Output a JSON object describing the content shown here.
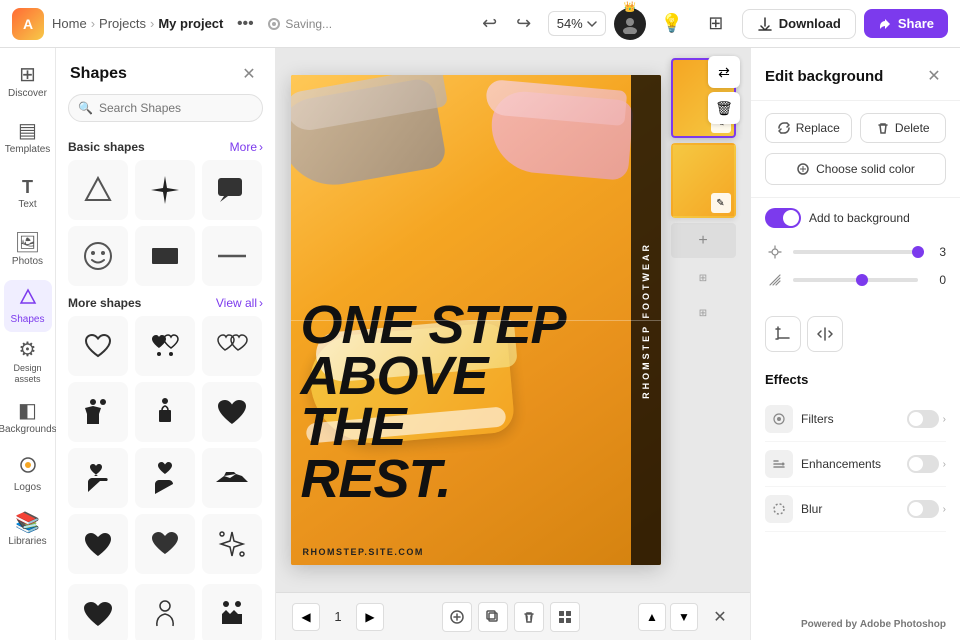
{
  "topbar": {
    "logo_text": "A",
    "breadcrumb": {
      "home": "Home",
      "projects": "Projects",
      "current": "My project"
    },
    "more_label": "•••",
    "saving_text": "Saving...",
    "zoom_level": "54%",
    "download_label": "Download",
    "share_label": "Share"
  },
  "sidebar": {
    "items": [
      {
        "id": "discover",
        "label": "Discover",
        "icon": "⊞"
      },
      {
        "id": "templates",
        "label": "Templates",
        "icon": "⊡"
      },
      {
        "id": "text",
        "label": "Text",
        "icon": "T"
      },
      {
        "id": "photos",
        "label": "Photos",
        "icon": "🖼"
      },
      {
        "id": "shapes",
        "label": "Shapes",
        "icon": "⬡",
        "active": true
      },
      {
        "id": "design-assets",
        "label": "Design assets",
        "icon": "🎨"
      },
      {
        "id": "backgrounds",
        "label": "Backgrounds",
        "icon": "◧"
      },
      {
        "id": "logos",
        "label": "Logos",
        "icon": "⊕"
      },
      {
        "id": "libraries",
        "label": "Libraries",
        "icon": "📚"
      }
    ]
  },
  "shapes_panel": {
    "title": "Shapes",
    "search_placeholder": "Search Shapes",
    "basic_shapes_label": "Basic shapes",
    "more_label": "More",
    "more_shapes_label": "More shapes",
    "view_all_label": "View all",
    "basic_shapes": [
      {
        "id": "triangle",
        "type": "triangle"
      },
      {
        "id": "star4",
        "type": "star4"
      },
      {
        "id": "speech",
        "type": "speech"
      },
      {
        "id": "circle-smile",
        "type": "circle-smile"
      },
      {
        "id": "rect",
        "type": "rect"
      },
      {
        "id": "line",
        "type": "line"
      }
    ],
    "more_shapes": [
      {
        "id": "heart-outline1",
        "type": "heart-outline"
      },
      {
        "id": "hearts2",
        "type": "two-hearts"
      },
      {
        "id": "hearts3",
        "type": "two-hearts-outline"
      },
      {
        "id": "people1",
        "type": "people-up"
      },
      {
        "id": "people2",
        "type": "gift-person"
      },
      {
        "id": "heart-solid",
        "type": "heart-solid"
      },
      {
        "id": "heart-hand1",
        "type": "heart-hand1"
      },
      {
        "id": "heart-hand2",
        "type": "heart-hand2"
      },
      {
        "id": "handshake",
        "type": "handshake"
      },
      {
        "id": "heart1",
        "type": "heart-small1"
      },
      {
        "id": "heart2",
        "type": "heart-small2"
      },
      {
        "id": "sparkle",
        "type": "sparkle"
      }
    ]
  },
  "canvas": {
    "text_line1": "ONE STEP",
    "text_line2": "ABOVE",
    "text_line3": "THE",
    "text_line4": "REST.",
    "side_text": "RHOMSTEP FOOTWEAR",
    "website": "RHOMSTEP.SITE.COM",
    "page_number": "1",
    "zoom": "54%"
  },
  "right_panel": {
    "title": "Edit background",
    "replace_label": "Replace",
    "delete_label": "Delete",
    "choose_color_label": "Choose solid color",
    "add_to_background_label": "Add to background",
    "toggle_active": true,
    "slider1_value": "3",
    "slider2_value": "0",
    "effects": {
      "title": "Effects",
      "items": [
        {
          "id": "filters",
          "name": "Filters",
          "icon": "🔒",
          "enabled": false
        },
        {
          "id": "enhancements",
          "name": "Enhancements",
          "icon": "⚙",
          "enabled": false
        },
        {
          "id": "blur",
          "name": "Blur",
          "icon": "○",
          "enabled": false
        }
      ]
    },
    "powered_by": "Powered by",
    "powered_by_brand": "Adobe Photoshop"
  },
  "bottom_bar": {
    "prev_page_icon": "◀",
    "next_page_icon": "▶",
    "page_number": "1",
    "add_page_icon": "+",
    "copy_icon": "⧉",
    "delete_icon": "🗑",
    "grid_icon": "⊞",
    "up_icon": "▲",
    "down_icon": "▼",
    "close_icon": "✕"
  }
}
